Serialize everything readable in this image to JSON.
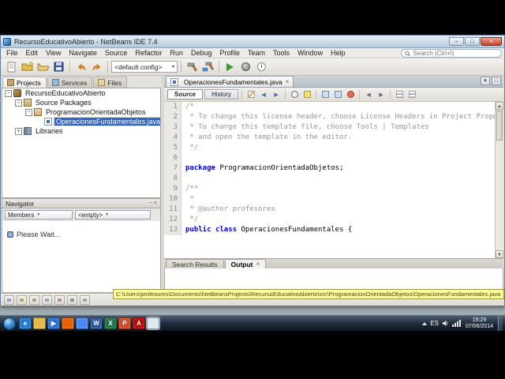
{
  "window": {
    "title": "RecursoEducativoAbierto - NetBeans IDE 7.4"
  },
  "menubar": {
    "items": [
      "File",
      "Edit",
      "View",
      "Navigate",
      "Source",
      "Refactor",
      "Run",
      "Debug",
      "Profile",
      "Team",
      "Tools",
      "Window",
      "Help"
    ]
  },
  "search": {
    "placeholder": "Search (Ctrl+I)"
  },
  "toolbar": {
    "config_value": "<default config>"
  },
  "left_panel": {
    "tabs": [
      {
        "label": "Projects",
        "active": true
      },
      {
        "label": "Services",
        "active": false
      },
      {
        "label": "Files",
        "active": false
      }
    ],
    "tree": [
      {
        "label": "RecursoEducativoAbierto",
        "indent": 0,
        "icon": "project-icon",
        "expander": "minus",
        "selected": false
      },
      {
        "label": "Source Packages",
        "indent": 1,
        "icon": "source-packages-icon",
        "expander": "minus",
        "selected": false
      },
      {
        "label": "ProgramacionOrientadaObjetos",
        "indent": 2,
        "icon": "package-icon",
        "expander": "minus",
        "selected": false
      },
      {
        "label": "OperacionesFundamentales.java",
        "indent": 3,
        "icon": "java-file-icon",
        "expander": "none",
        "selected": true
      },
      {
        "label": "Libraries",
        "indent": 1,
        "icon": "libraries-icon",
        "expander": "plus",
        "selected": false
      }
    ],
    "navigator": {
      "title": "Navigator",
      "combo1": "Members",
      "combo2": "<empty>",
      "status": "Please Wait..."
    }
  },
  "editor": {
    "tab_label": "OperacionesFundamentales.java",
    "views": {
      "source": "Source",
      "history": "History"
    },
    "code": [
      {
        "n": "1",
        "parts": [
          [
            "/*",
            "c"
          ]
        ]
      },
      {
        "n": "2",
        "parts": [
          [
            " * To change this license header, choose License Headers in Project Properties.",
            "c"
          ]
        ]
      },
      {
        "n": "3",
        "parts": [
          [
            " * To change this template file, choose Tools | Templates",
            "c"
          ]
        ]
      },
      {
        "n": "4",
        "parts": [
          [
            " * and open the template in the editor.",
            "c"
          ]
        ]
      },
      {
        "n": "5",
        "parts": [
          [
            " */",
            "c"
          ]
        ]
      },
      {
        "n": "6",
        "parts": [
          [
            "",
            "p"
          ]
        ]
      },
      {
        "n": "7",
        "parts": [
          [
            "package",
            "k"
          ],
          [
            " ProgramacionOrientadaObjetos;",
            "p"
          ]
        ]
      },
      {
        "n": "8",
        "parts": [
          [
            "",
            "p"
          ]
        ]
      },
      {
        "n": "9",
        "parts": [
          [
            "/**",
            "c"
          ]
        ]
      },
      {
        "n": "10",
        "parts": [
          [
            " *",
            "c"
          ]
        ]
      },
      {
        "n": "11",
        "parts": [
          [
            " * @author profesores",
            "c"
          ]
        ]
      },
      {
        "n": "12",
        "parts": [
          [
            " */",
            "c"
          ]
        ]
      },
      {
        "n": "13",
        "parts": [
          [
            "public",
            "k"
          ],
          [
            " ",
            "p"
          ],
          [
            "class",
            "k"
          ],
          [
            " OperacionesFundamentales {",
            "p"
          ]
        ]
      }
    ]
  },
  "status_path": "C:\\Users\\profesores\\Documents\\NetBeansProjects\\RecursoEducativoAbierto\\src\\ProgramacionOrientadaObjetos\\OperacionesFundamentales.java",
  "bottom_panel": {
    "tabs": [
      {
        "label": "Search Results",
        "active": false
      },
      {
        "label": "Output",
        "active": true
      }
    ]
  },
  "taskbar": {
    "icons": [
      {
        "name": "internet-explorer",
        "color": "#1e7ad1",
        "glyph": "e"
      },
      {
        "name": "windows-explorer",
        "color": "#e3b94d",
        "glyph": ""
      },
      {
        "name": "media-player",
        "color": "#2a6fd4",
        "glyph": "▶"
      },
      {
        "name": "firefox",
        "color": "#e66000",
        "glyph": ""
      },
      {
        "name": "chrome",
        "color": "#4a8af4",
        "glyph": ""
      },
      {
        "name": "word",
        "color": "#2b579a",
        "glyph": "W"
      },
      {
        "name": "excel",
        "color": "#217346",
        "glyph": "X"
      },
      {
        "name": "powerpoint",
        "color": "#d24726",
        "glyph": "P"
      },
      {
        "name": "acrobat",
        "color": "#b30b00",
        "glyph": "A"
      },
      {
        "name": "netbeans",
        "color": "#dfe8f0",
        "glyph": "",
        "active": true
      }
    ],
    "tray": {
      "language": "ES",
      "time": "19:29",
      "date": "07/06/2014"
    }
  },
  "icons": {
    "close": "×",
    "minimize": "−",
    "maximize": "□",
    "tab-close": "×",
    "dropdown": "▾",
    "plus": "+",
    "minus": "−",
    "back": "◀",
    "forward": "▶",
    "scroll-up": "▲",
    "scroll-down": "▼"
  },
  "colors": {
    "selection": "#2f65c8",
    "keyword": "#0000e6",
    "comment": "#969696",
    "path_bg": "#fbfba0"
  }
}
